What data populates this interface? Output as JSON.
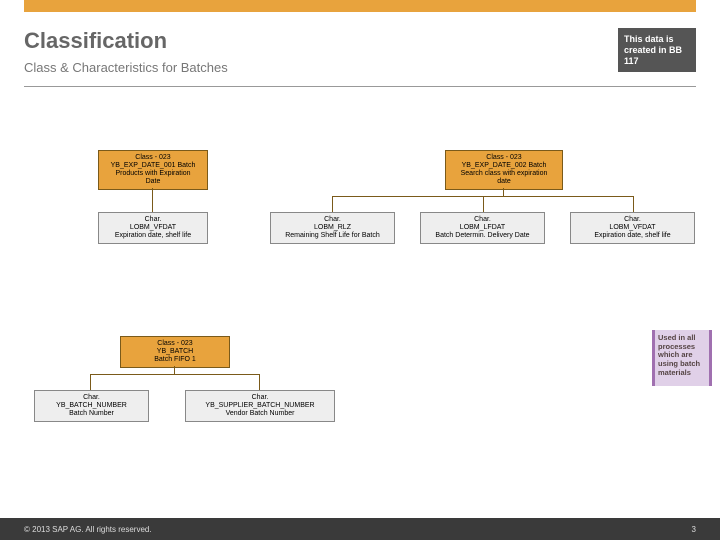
{
  "header": {
    "title": "Classification",
    "subtitle": "Class & Characteristics for Batches",
    "badge": "This data is created in BB 117"
  },
  "group1": {
    "class_line1": "Class - 023",
    "class_line2": "YB_EXP_DATE_001 Batch",
    "class_line3": "Products with Expiration",
    "class_line4": "Date",
    "char1_line1": "Char.",
    "char1_line2": "LOBM_VFDAT",
    "char1_line3": "Expiration date, shelf life"
  },
  "group2": {
    "class_line1": "Class - 023",
    "class_line2": "YB_EXP_DATE_002 Batch",
    "class_line3": "Search class with expiration",
    "class_line4": "date",
    "char1_line1": "Char.",
    "char1_line2": "LOBM_RLZ",
    "char1_line3": "Remaining Shelf Life for Batch",
    "char2_line1": "Char.",
    "char2_line2": "LOBM_LFDAT",
    "char2_line3": "Batch Determin. Delivery Date",
    "char3_line1": "Char.",
    "char3_line2": "LOBM_VFDAT",
    "char3_line3": "Expiration date, shelf life"
  },
  "group3": {
    "class_line1": "Class - 023",
    "class_line2": "YB_BATCH",
    "class_line3": "Batch FIFO 1",
    "char1_line1": "Char.",
    "char1_line2": "YB_BATCH_NUMBER",
    "char1_line3": "Batch Number",
    "char2_line1": "Char.",
    "char2_line2": "YB_SUPPLIER_BATCH_NUMBER",
    "char2_line3": "Vendor Batch Number"
  },
  "side_note": "Used in all processes which are using batch materials",
  "footer": {
    "copyright": "©  2013 SAP AG. All rights reserved.",
    "page": "3"
  }
}
